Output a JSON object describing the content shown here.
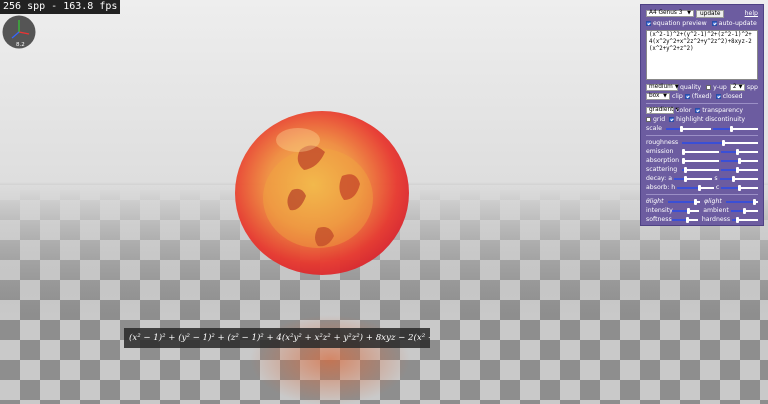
{
  "overlay": {
    "fps_text": "256 spp - 163.8 fps",
    "gizmo": {
      "x": "x",
      "y": "y",
      "z": "z",
      "zoom": "8.2"
    },
    "equation_rendered": "(x² − 1)² + (y² − 1)² + (z² − 1)² + 4(x²y² + x²z² + y²z²) + 8xyz − 2(x² + y² + z²) = 0"
  },
  "panel": {
    "preset": "A4 Genus 3",
    "update_label": "update",
    "help_label": "help",
    "equation_preview": {
      "label": "equation preview",
      "checked": true
    },
    "auto_update": {
      "label": "auto-update",
      "checked": true
    },
    "equation_text": "(x^2-1)^2+(y^2-1)^2+(z^2-1)^2+4(x^2y^2+x^2z^2+y^2z^2)+8xyz-2(x^2+y^2+z^2)",
    "quality": {
      "value": "medium",
      "label": "quality"
    },
    "y_up": {
      "label": "y-up",
      "checked": false
    },
    "spp": {
      "value": "2",
      "label": "spp"
    },
    "clip": {
      "value": "box",
      "label": "clip"
    },
    "fixed": {
      "label": "fixed",
      "checked": true
    },
    "closed": {
      "label": "closed",
      "checked": true
    },
    "color_mode": {
      "value": "gradient",
      "label": "color"
    },
    "transparency": {
      "label": "transparency",
      "checked": true
    },
    "grid": {
      "label": "grid",
      "checked": false
    },
    "highlight_discontinuity": {
      "label": "highlight discontinuity",
      "checked": true
    },
    "scale_label": "scale",
    "roughness_label": "roughness",
    "emission_label": "emission",
    "absorption_label": "absorption",
    "scattering_label": "scattering",
    "decay_label": "decay:",
    "decay_a": "a",
    "decay_s": "s",
    "absorb_label": "absorb:",
    "absorb_h": "h",
    "absorb_c": "c",
    "theta_light": "θlight",
    "phi_light": "φlight",
    "intensity_label": "intensity",
    "ambient_label": "ambient",
    "softness_label": "softness",
    "hardness_label": "hardness",
    "sliders": {
      "scale_a": 0.35,
      "scale_b": 0.4,
      "roughness": 0.55,
      "emission_a": 0.05,
      "emission_b": 0.45,
      "absorption_a": 0.05,
      "absorption_b": 0.5,
      "scattering_a": 0.1,
      "scattering_b": 0.45,
      "decay_a": 0.3,
      "decay_s": 0.35,
      "absorb_h": 0.6,
      "absorb_c": 0.5,
      "theta": 0.85,
      "phi": 0.9,
      "intensity": 0.6,
      "ambient": 0.5,
      "softness": 0.6,
      "hardness": 0.2
    }
  }
}
